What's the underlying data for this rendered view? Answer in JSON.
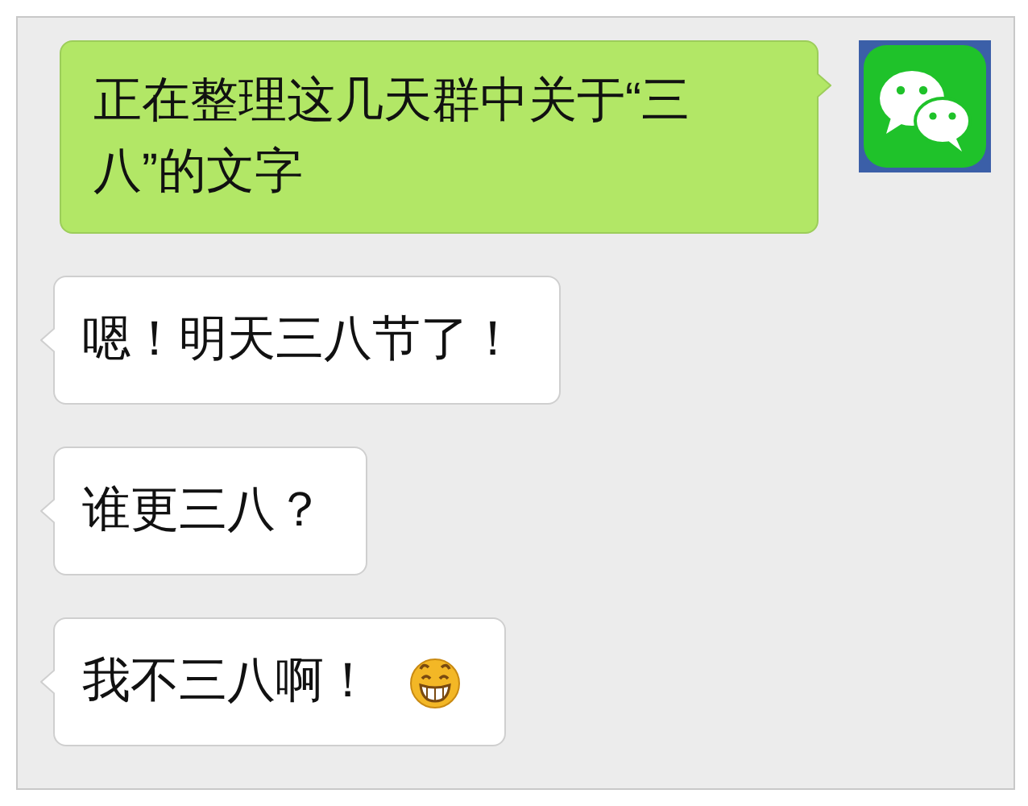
{
  "messages": [
    {
      "kind": "sent",
      "text": "正在整理这几天群中关于“三八”的文字",
      "emoji": false
    },
    {
      "kind": "received",
      "text": "嗯！明天三八节了！",
      "emoji": false
    },
    {
      "kind": "received",
      "text": "谁更三八？",
      "emoji": false
    },
    {
      "kind": "received",
      "text": "我不三八啊！",
      "emoji": true
    }
  ]
}
